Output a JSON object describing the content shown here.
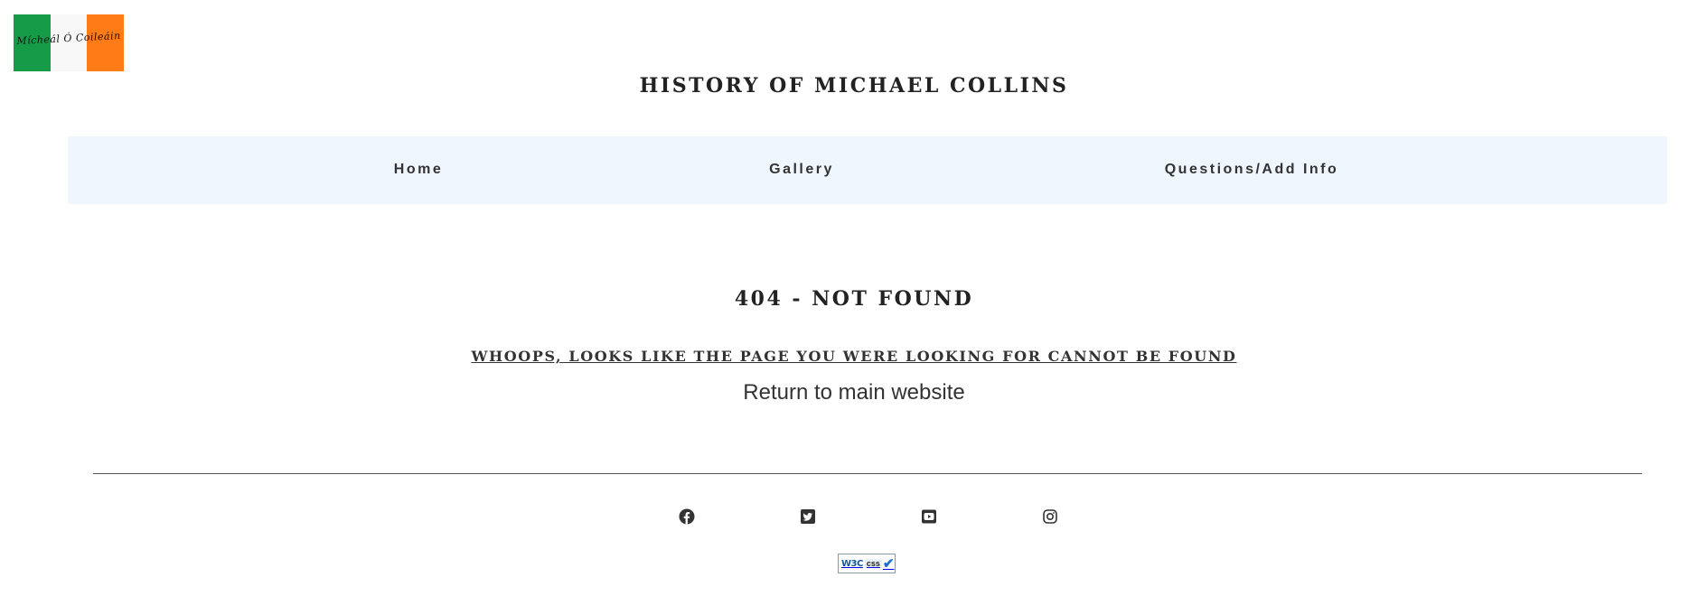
{
  "logo": {
    "signature": "Mícheál Ó Coileáin",
    "flag_colors": [
      "#169b49",
      "#f8f8f8",
      "#ff7b16"
    ]
  },
  "site_title": "HISTORY OF MICHAEL COLLINS",
  "nav": {
    "items": [
      "Home",
      "Gallery",
      "Questions/Add Info"
    ],
    "background": "#eff6fd"
  },
  "error": {
    "title": "404 - NOT FOUND",
    "subtitle": "WHOOPS, LOOKS LIKE THE PAGE YOU WERE LOOKING FOR CANNOT BE FOUND",
    "return_link": "Return to main website"
  },
  "footer": {
    "social_icons": [
      "facebook-icon",
      "twitter-icon",
      "youtube-icon",
      "instagram-icon"
    ],
    "badge": {
      "w3c": "W3C",
      "css": "css"
    }
  }
}
